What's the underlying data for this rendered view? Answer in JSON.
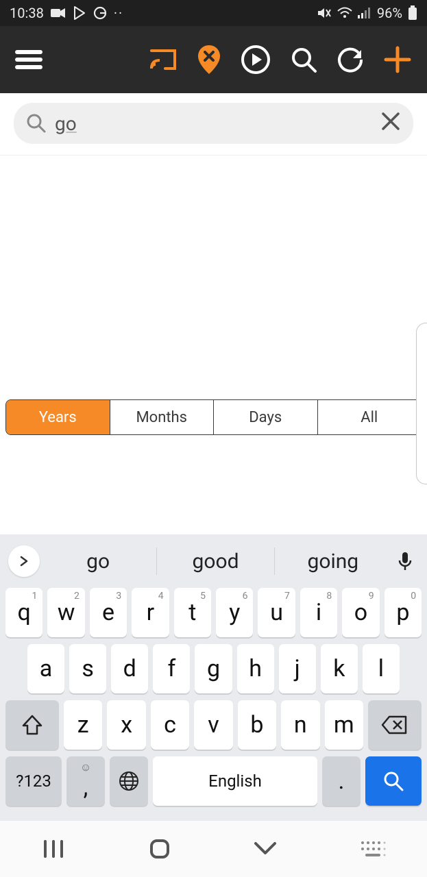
{
  "status": {
    "time": "10:38",
    "battery": "96%"
  },
  "search": {
    "value": "go",
    "placeholder": ""
  },
  "segments": {
    "items": [
      "Years",
      "Months",
      "Days",
      "All"
    ],
    "active": 0
  },
  "keyboard": {
    "suggestions": [
      "go",
      "good",
      "going"
    ],
    "row1": [
      {
        "k": "q",
        "n": "1"
      },
      {
        "k": "w",
        "n": "2"
      },
      {
        "k": "e",
        "n": "3"
      },
      {
        "k": "r",
        "n": "4"
      },
      {
        "k": "t",
        "n": "5"
      },
      {
        "k": "y",
        "n": "6"
      },
      {
        "k": "u",
        "n": "7"
      },
      {
        "k": "i",
        "n": "8"
      },
      {
        "k": "o",
        "n": "9"
      },
      {
        "k": "p",
        "n": "0"
      }
    ],
    "row2": [
      "a",
      "s",
      "d",
      "f",
      "g",
      "h",
      "j",
      "k",
      "l"
    ],
    "row3": [
      "z",
      "x",
      "c",
      "v",
      "b",
      "n",
      "m"
    ],
    "sym": "?123",
    "comma": ",",
    "space": "English",
    "period": "."
  }
}
